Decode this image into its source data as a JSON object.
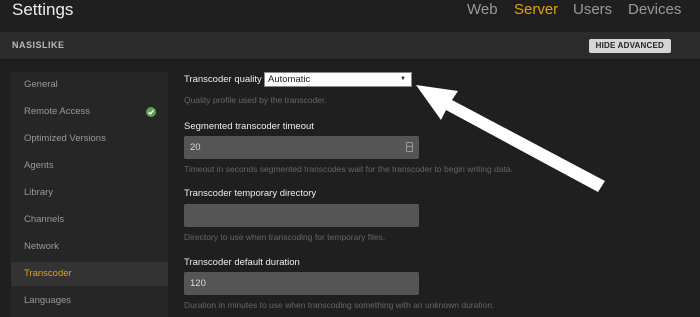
{
  "app": {
    "title": "Settings"
  },
  "nav": {
    "items": [
      {
        "label": "Web",
        "active": false
      },
      {
        "label": "Server",
        "active": true
      },
      {
        "label": "Users",
        "active": false
      },
      {
        "label": "Devices",
        "active": false
      }
    ]
  },
  "server": {
    "name": "NASISLIKE",
    "hide_advanced_label": "HIDE ADVANCED"
  },
  "sidebar": {
    "items": [
      {
        "label": "General",
        "active": false
      },
      {
        "label": "Remote Access",
        "active": false,
        "status_icon": "check-circle-icon"
      },
      {
        "label": "Optimized Versions",
        "active": false
      },
      {
        "label": "Agents",
        "active": false
      },
      {
        "label": "Library",
        "active": false
      },
      {
        "label": "Channels",
        "active": false
      },
      {
        "label": "Network",
        "active": false
      },
      {
        "label": "Transcoder",
        "active": true
      },
      {
        "label": "Languages",
        "active": false
      }
    ]
  },
  "settings": {
    "quality": {
      "label": "Transcoder quality",
      "value": "Automatic",
      "help": "Quality profile used by the transcoder."
    },
    "segmented_timeout": {
      "label": "Segmented transcoder timeout",
      "value": "20",
      "help": "Timeout in seconds segmented transcodes wait for the transcoder to begin writing data."
    },
    "temp_dir": {
      "label": "Transcoder temporary directory",
      "value": "",
      "help": "Directory to use when transcoding for temporary files."
    },
    "default_duration": {
      "label": "Transcoder default duration",
      "value": "120",
      "help": "Duration in minutes to use when transcoding something with an unknown duration."
    }
  },
  "colors": {
    "accent": "#e5a00d",
    "background": "#1f1f1f",
    "success": "#57a64a"
  }
}
